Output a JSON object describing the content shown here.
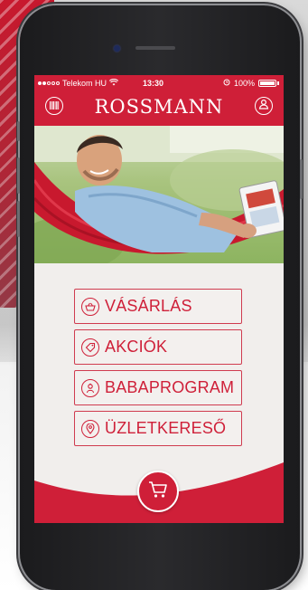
{
  "colors": {
    "brand_red": "#cf1f38",
    "screen_bg": "#f1eeec",
    "text_white": "#ffffff"
  },
  "status_bar": {
    "carrier": "Telekom HU",
    "time": "13:30",
    "battery": "100%"
  },
  "header": {
    "logo_text": "ROSSMANN",
    "left_icon": "barcode-icon",
    "right_icon": "user-profile-icon"
  },
  "menu": {
    "items": [
      {
        "label": "VÁSÁRLÁS",
        "icon": "shopping-basket-icon"
      },
      {
        "label": "AKCIÓK",
        "icon": "price-tag-icon"
      },
      {
        "label": "BABAPROGRAM",
        "icon": "baby-icon"
      },
      {
        "label": "ÜZLETKERESŐ",
        "icon": "location-pin-icon"
      }
    ]
  },
  "footer": {
    "cart_icon": "shopping-cart-icon"
  }
}
